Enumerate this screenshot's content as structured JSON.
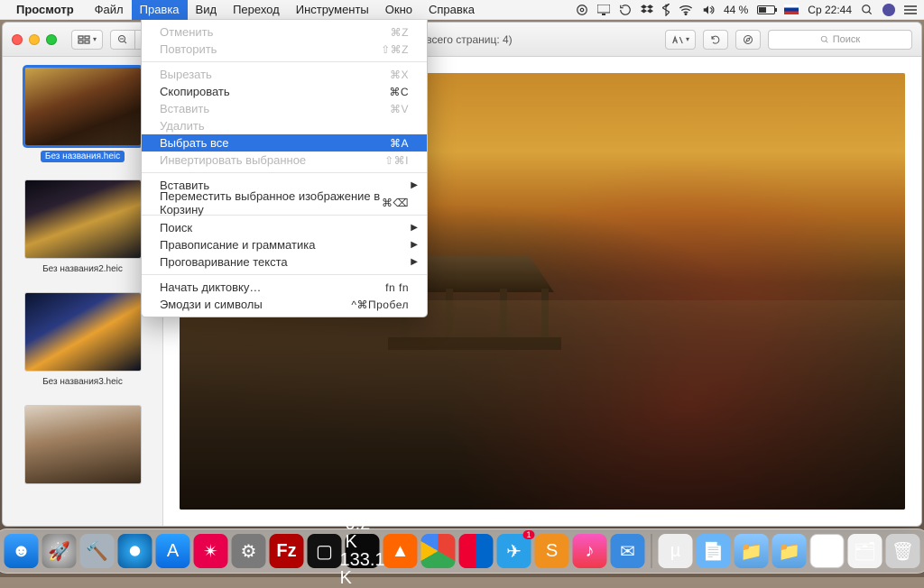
{
  "menubar": {
    "app": "Просмотр",
    "items": [
      "Файл",
      "Правка",
      "Вид",
      "Переход",
      "Инструменты",
      "Окно",
      "Справка"
    ],
    "active_index": 1,
    "right": {
      "battery_pct": "44 %",
      "clock": "Ср 22:44"
    }
  },
  "dropdown": [
    {
      "label": "Отменить",
      "shortcut": "⌘Z",
      "disabled": true
    },
    {
      "label": "Повторить",
      "shortcut": "⇧⌘Z",
      "disabled": true
    },
    {
      "sep": true
    },
    {
      "label": "Вырезать",
      "shortcut": "⌘X",
      "disabled": true
    },
    {
      "label": "Скопировать",
      "shortcut": "⌘C"
    },
    {
      "label": "Вставить",
      "shortcut": "⌘V",
      "disabled": true
    },
    {
      "label": "Удалить",
      "disabled": true
    },
    {
      "label": "Выбрать все",
      "shortcut": "⌘A",
      "highlight": true
    },
    {
      "label": "Инвертировать выбранное",
      "shortcut": "⇧⌘I",
      "disabled": true
    },
    {
      "sep": true
    },
    {
      "label": "Вставить",
      "submenu": true
    },
    {
      "label": "Переместить выбранное изображение в Корзину",
      "shortcut": "⌘⌫"
    },
    {
      "sep": true
    },
    {
      "label": "Поиск",
      "submenu": true
    },
    {
      "label": "Правописание и грамматика",
      "submenu": true
    },
    {
      "label": "Проговаривание текста",
      "submenu": true
    },
    {
      "sep": true
    },
    {
      "label": "Начать диктовку…",
      "shortcut": "fn fn"
    },
    {
      "label": "Эмодзи и символы",
      "shortcut": "^⌘Пробел"
    }
  ],
  "window": {
    "title": "(документов: 4, всего страниц: 4)",
    "search_placeholder": "Поиск"
  },
  "thumbs": [
    {
      "label": "Без названия.heic",
      "cls": "th1",
      "selected": true
    },
    {
      "label": "Без названия2.heic",
      "cls": "th2"
    },
    {
      "label": "Без названия3.heic",
      "cls": "th3"
    },
    {
      "label": "",
      "cls": "th4"
    }
  ],
  "dock": {
    "net_up": "0.2 K",
    "net_down": "133.1 K",
    "telegram_badge": "1"
  }
}
